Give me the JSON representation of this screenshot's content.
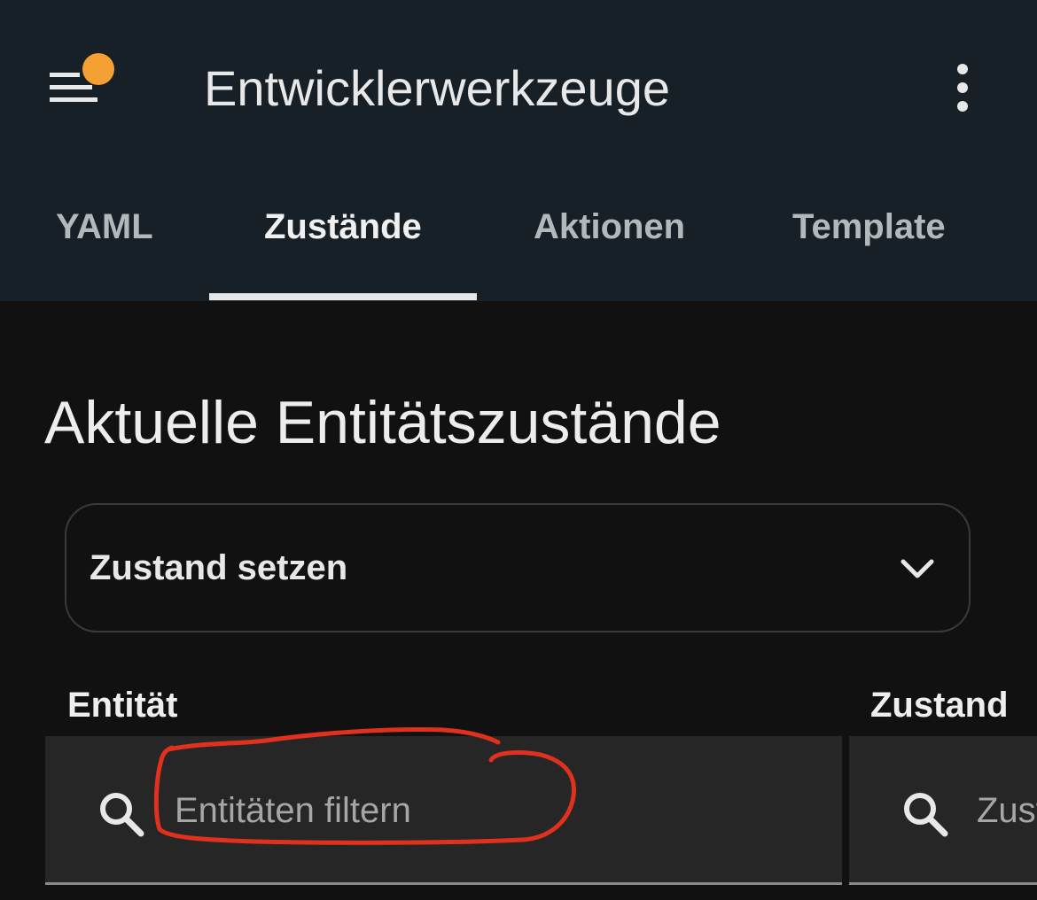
{
  "header": {
    "title": "Entwicklerwerkzeuge",
    "menu_icon": "menu-icon",
    "notification_dot_color": "#f5a033",
    "overflow_icon": "more-vertical-icon"
  },
  "tabs": [
    {
      "label": "YAML",
      "active": false
    },
    {
      "label": "Zustände",
      "active": true
    },
    {
      "label": "Aktionen",
      "active": false
    },
    {
      "label": "Template",
      "active": false
    }
  ],
  "main": {
    "title": "Aktuelle Entitätszustände",
    "set_state": {
      "label": "Zustand setzen",
      "icon": "chevron-down-icon"
    },
    "columns": {
      "entity": {
        "header": "Entität",
        "filter_placeholder": "Entitäten filtern",
        "filter_value": ""
      },
      "state": {
        "header": "Zustand",
        "filter_placeholder": "Zustand filtern",
        "filter_value": ""
      }
    }
  },
  "colors": {
    "appbar": "#162026",
    "background": "#111111",
    "field_background": "#262626",
    "annotation": "#e0301e"
  }
}
